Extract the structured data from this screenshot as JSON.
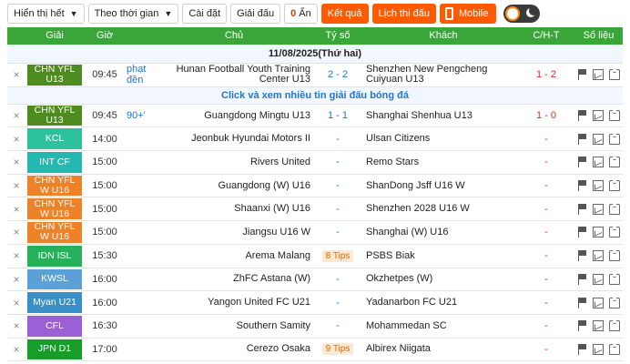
{
  "toolbar": {
    "show_all": "Hiển thị hết",
    "by_time": "Theo thời gian",
    "settings": "Cài đặt",
    "leagues": "Giải đấu",
    "hide_count": "0",
    "hide_label": "Ẩn",
    "results": "Kết quả",
    "schedule": "Lịch thi đấu",
    "mobile": "Mobile"
  },
  "header": {
    "league": "Giải",
    "time": "Giờ",
    "home": "Chủ",
    "score": "Tỷ số",
    "away": "Khách",
    "ht": "C/H-T",
    "stats": "Số liệu"
  },
  "date": "11/08/2025(Thứ hai)",
  "promo": "Click và xem nhiều tin giải đấu bóng đá",
  "colors": {
    "header_green": "#3aa63a",
    "orange": "#ff5a00",
    "link_blue": "#1f76c9",
    "ht_red": "#e0242a"
  },
  "matches": [
    {
      "league": "CHN YFL U13",
      "league_color": "#4f8c1f",
      "time": "09:45",
      "live": "phạt đền",
      "home": "Hunan Football Youth Training Center U13",
      "score": "2 - 2",
      "away": "Shenzhen New Pengcheng Cuiyuan U13",
      "ht": "1 - 2"
    },
    {
      "league": "CHN YFL U13",
      "league_color": "#4f8c1f",
      "time": "09:45",
      "live": "90+'",
      "home": "Guangdong Mingtu U13",
      "score": "1 - 1",
      "away": "Shanghai Shenhua U13",
      "ht": "1 - 0"
    },
    {
      "league": "KCL",
      "league_color": "#2bc29d",
      "time": "14:00",
      "live": "",
      "home": "Jeonbuk Hyundai Motors II",
      "score": "-",
      "away": "Ulsan Citizens",
      "ht": "-"
    },
    {
      "league": "INT CF",
      "league_color": "#25b8b0",
      "time": "15:00",
      "live": "",
      "home": "Rivers United",
      "score": "-",
      "away": "Remo Stars",
      "ht": "-"
    },
    {
      "league": "CHN YFL W U16",
      "league_color": "#ee8228",
      "time": "15:00",
      "live": "",
      "home": "Guangdong (W) U16",
      "score": "-",
      "away": "ShanDong Jsff U16 W",
      "ht": "-"
    },
    {
      "league": "CHN YFL W U16",
      "league_color": "#ee8228",
      "time": "15:00",
      "live": "",
      "home": "Shaanxi (W) U16",
      "score": "-",
      "away": "Shenzhen 2028 U16 W",
      "ht": "-"
    },
    {
      "league": "CHN YFL W U16",
      "league_color": "#ee8228",
      "time": "15:00",
      "live": "",
      "home": "Jiangsu U16 W",
      "score": "-",
      "away": "Shanghai (W) U16",
      "ht": "-"
    },
    {
      "league": "IDN ISL",
      "league_color": "#27b05a",
      "time": "15:30",
      "live": "",
      "home": "Arema Malang",
      "score": "8 Tips",
      "away": "PSBS Biak",
      "ht": "-"
    },
    {
      "league": "KWSL",
      "league_color": "#5ba0d6",
      "time": "16:00",
      "live": "",
      "home": "ZhFC Astana (W)",
      "score": "-",
      "away": "Okzhetpes (W)",
      "ht": "-"
    },
    {
      "league": "Myan U21",
      "league_color": "#3a8fc8",
      "time": "16:00",
      "live": "",
      "home": "Yangon United FC U21",
      "score": "-",
      "away": "Yadanarbon FC U21",
      "ht": "-"
    },
    {
      "league": "CFL",
      "league_color": "#9b5fd6",
      "time": "16:30",
      "live": "",
      "home": "Southern Samity",
      "score": "-",
      "away": "Mohammedan SC",
      "ht": "-"
    },
    {
      "league": "JPN D1",
      "league_color": "#179e2a",
      "time": "17:00",
      "live": "",
      "home": "Cerezo Osaka",
      "score": "9 Tips",
      "away": "Albirex Niigata",
      "ht": "-"
    }
  ]
}
